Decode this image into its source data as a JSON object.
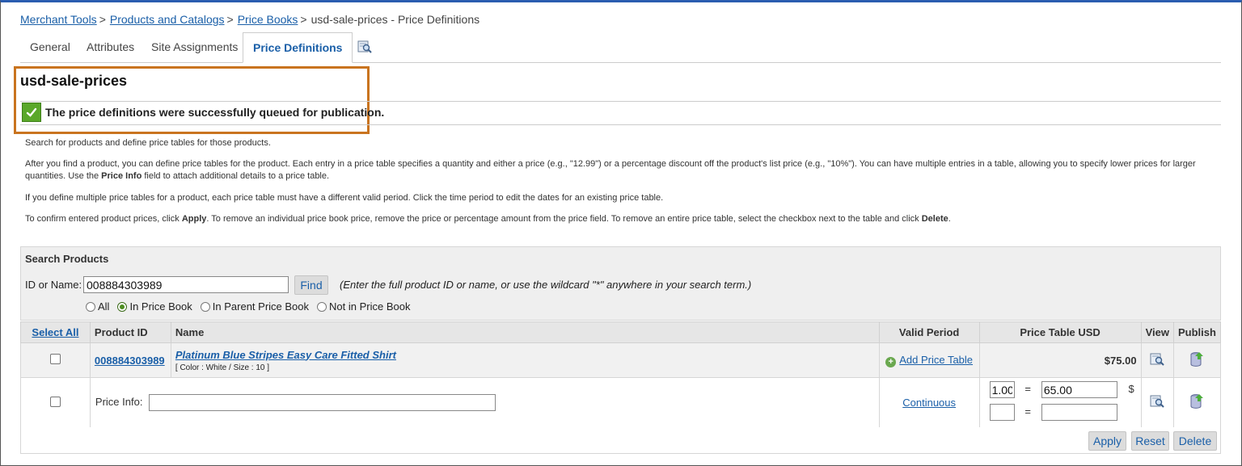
{
  "breadcrumb": {
    "items": [
      "Merchant Tools",
      "Products and Catalogs",
      "Price Books"
    ],
    "current": "usd-sale-prices - Price Definitions",
    "separator": ">"
  },
  "tabs": {
    "general": "General",
    "attributes": "Attributes",
    "site_assignments": "Site Assignments",
    "price_definitions": "Price Definitions",
    "preview_icon": "preview-icon"
  },
  "page": {
    "title": "usd-sale-prices",
    "success_message": "The price definitions were successfully queued for publication."
  },
  "help": {
    "p1": "Search for products and define price tables for those products.",
    "p2_a": "After you find a product, you can define price tables for the product. Each entry in a price table specifies a quantity and either a price (e.g., \"12.99\") or a percentage discount off the product's list price (e.g., \"10%\"). You can have multiple entries in a table, allowing you to specify lower prices for larger quantities. Use the ",
    "p2_bold": "Price Info",
    "p2_b": " field to attach additional details to a price table.",
    "p3": "If you define multiple price tables for a product, each price table must have a different valid period. Click the time period to edit the dates for an existing price table.",
    "p4_a": "To confirm entered product prices, click ",
    "p4_apply": "Apply",
    "p4_b": ". To remove an individual price book price, remove the price or percentage amount from the price field. To remove an entire price table, select the checkbox next to the table and click ",
    "p4_delete": "Delete",
    "p4_c": "."
  },
  "search": {
    "title": "Search Products",
    "label": "ID or Name:",
    "value": "008884303989",
    "find": "Find",
    "hint": "(Enter the full product ID or name, or use the wildcard \"*\" anywhere in your search term.)",
    "radios": [
      "All",
      "In Price Book",
      "In Parent Price Book",
      "Not in Price Book"
    ],
    "selected": "In Price Book"
  },
  "table": {
    "headers": {
      "select_all": "Select All",
      "product_id": "Product ID",
      "name": "Name",
      "valid_period": "Valid Period",
      "price_table": "Price Table USD",
      "view": "View",
      "publish": "Publish"
    },
    "product": {
      "id": "008884303989",
      "name": "Platinum Blue Stripes Easy Care Fitted Shirt",
      "variant": "[ Color :  White / Size :  10 ]",
      "add_price_table": "Add Price Table",
      "list_price": "$75.00"
    },
    "price_row": {
      "price_info_label": "Price Info:",
      "price_info_value": "",
      "valid_period": "Continuous",
      "qty1": "1.00",
      "eq": "=",
      "price1": "65.00",
      "currency": "$",
      "qty2": "",
      "price2": ""
    }
  },
  "actions": {
    "apply": "Apply",
    "reset": "Reset",
    "delete": "Delete"
  },
  "colors": {
    "link": "#1a5fa8",
    "highlight": "#c9741f",
    "success": "#5aa82a"
  }
}
